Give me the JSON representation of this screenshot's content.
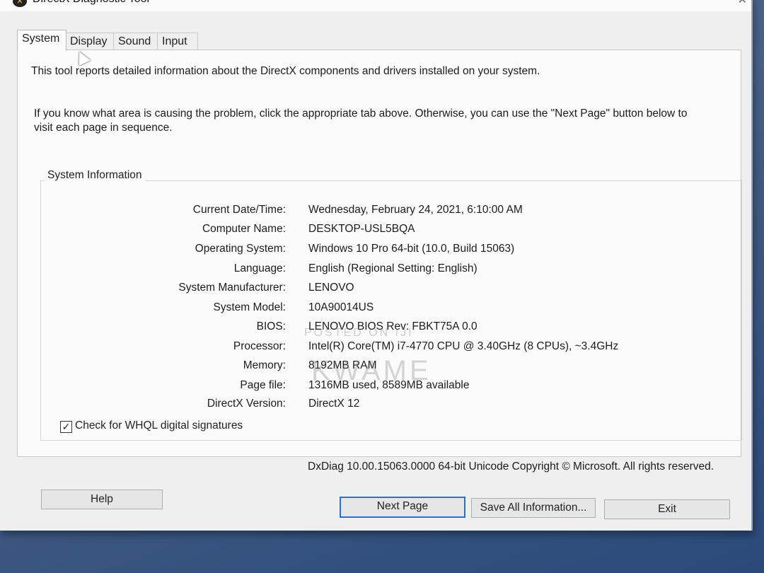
{
  "window": {
    "title": "DirectX Diagnostic Tool",
    "close_glyph": "✕",
    "icon": "directx-x-icon"
  },
  "tabs": [
    {
      "label": "System",
      "active": true
    },
    {
      "label": "Display"
    },
    {
      "label": "Sound"
    },
    {
      "label": "Input"
    }
  ],
  "intro": {
    "line1": "This tool reports detailed information about the DirectX components and drivers installed on your system.",
    "line2a": "If you know what area is causing the problem, click the appropriate tab above.  Otherwise, you can use the \"Next Page\" button below to",
    "line2b": "visit each page in sequence."
  },
  "system_info": {
    "title": "System Information",
    "rows": [
      {
        "label": "Current Date/Time:",
        "value": "Wednesday, February 24, 2021, 6:10:00 AM"
      },
      {
        "label": "Computer Name:",
        "value": "DESKTOP-USL5BQA"
      },
      {
        "label": "Operating System:",
        "value": "Windows 10 Pro 64-bit (10.0, Build 15063)"
      },
      {
        "label": "Language:",
        "value": "English (Regional Setting: English)"
      },
      {
        "label": "System Manufacturer:",
        "value": "LENOVO"
      },
      {
        "label": "System Model:",
        "value": "10A90014US"
      },
      {
        "label": "BIOS:",
        "value": "LENOVO BIOS Rev: FBKT75A 0.0"
      },
      {
        "label": "Processor:",
        "value": "Intel(R) Core(TM) i7-4770 CPU @ 3.40GHz (8 CPUs), ~3.4GHz"
      },
      {
        "label": "Memory:",
        "value": "8192MB RAM"
      },
      {
        "label": "Page file:",
        "value": "1316MB used, 8589MB available"
      },
      {
        "label": "DirectX Version:",
        "value": "DirectX 12"
      }
    ]
  },
  "whql": {
    "label": "Check for WHQL digital signatures",
    "checked": true,
    "mark": "✓"
  },
  "footer": "DxDiag 10.00.15063.0000 64-bit Unicode  Copyright © Microsoft. All rights reserved.",
  "buttons": {
    "help": "Help",
    "next_page": "Next Page",
    "save_all": "Save All Information...",
    "exit": "Exit"
  },
  "watermark": {
    "line1": "POSTED ON IJI",
    "line2": "KWAME"
  }
}
